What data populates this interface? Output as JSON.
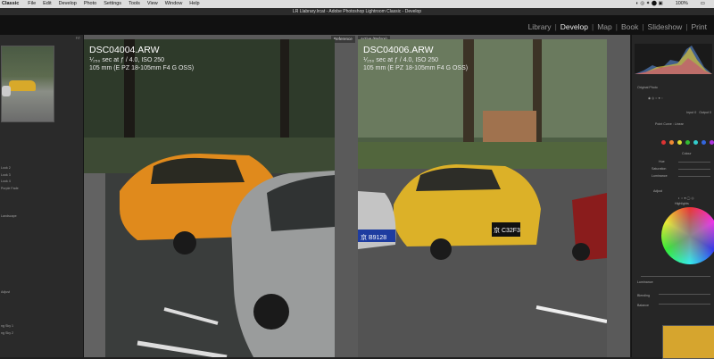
{
  "menubar": {
    "app": "Classic",
    "items": [
      "File",
      "Edit",
      "Develop",
      "Photo",
      "Settings",
      "Tools",
      "View",
      "Window",
      "Help"
    ],
    "battery": "100%"
  },
  "window": {
    "title": "LR Llabrary.lrcat - Adobe Photoshop Lightroom Classic - Develop"
  },
  "modules": {
    "items": [
      "Library",
      "Develop",
      "Map",
      "Book",
      "Slideshow",
      "Print"
    ],
    "active": "Develop"
  },
  "left": {
    "navigator_modes": "FIT",
    "presets": [
      "Look 2",
      "Look 3",
      "Look 4",
      "Purple Fade",
      "",
      "",
      "",
      "",
      "",
      "Landscape",
      "",
      "",
      "",
      "",
      "",
      "",
      "",
      "",
      "",
      "",
      "",
      "Adjust",
      "",
      "",
      "",
      "",
      "",
      "",
      "",
      "",
      "ng Sky 1",
      "ng Sky 2",
      "",
      "",
      "",
      "",
      "",
      "",
      "",
      "",
      "",
      ""
    ]
  },
  "reference": {
    "tag": "Reference",
    "filename": "DSC04004.ARW",
    "exposure": "⅟₂₅₀ sec at ƒ / 4.0, ISO 250",
    "lens": "105 mm (E PZ 18-105mm F4 G OSS)"
  },
  "active": {
    "tag": "Active (Before)",
    "filename": "DSC04006.ARW",
    "exposure": "⅟₂₅₀ sec at ƒ / 4.0, ISO 250",
    "lens": "105 mm (E PZ 18-105mm F4 G OSS)",
    "plate_left": "京 B9128",
    "plate_right": "京 C32F3"
  },
  "right": {
    "original_photo": "Original Photo",
    "point_curve": "Point Curve",
    "point_curve_value": "Linear",
    "input_label": "Input",
    "input_value": "0",
    "output_label": "Output",
    "output_value": "0",
    "section_colour": "Colour",
    "hue": "Hue",
    "saturation": "Saturation",
    "luminance": "Luminance",
    "adjust": "Adjust",
    "highlights": "Highlights",
    "blend": "Blending",
    "balance": "Balance",
    "luminance2": "Luminance"
  },
  "colors": {
    "swatches": [
      "#d33",
      "#e83",
      "#dd3",
      "#3b3",
      "#3cc",
      "#36d",
      "#a3d",
      "#d3a"
    ]
  }
}
